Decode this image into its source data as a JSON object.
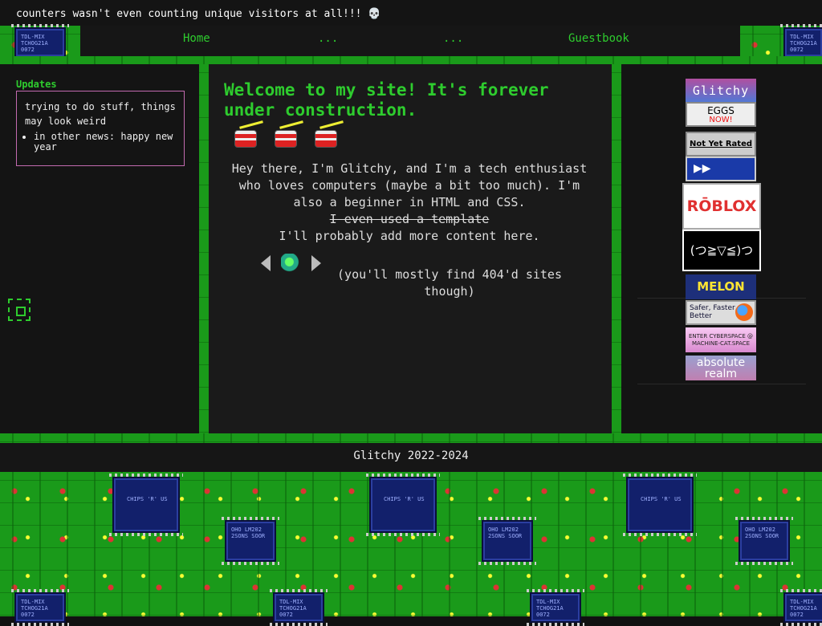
{
  "marquee": {
    "text": "counters wasn't even counting unique visitors at all!!! 💀"
  },
  "nav": {
    "home": "Home",
    "item2": "...",
    "item3": "...",
    "guestbook": "Guestbook"
  },
  "updates": {
    "title": "Updates",
    "body": "trying to do stuff, things may look weird",
    "bullet": "in other news: happy new year"
  },
  "main": {
    "welcome": "Welcome to my site! It's forever under construction.",
    "intro_line1": "Hey there, I'm Glitchy, and I'm a tech enthusiast who loves computers (maybe a bit too much). I'm also a beginner in HTML and CSS.",
    "intro_strike": "I even used a template",
    "intro_line2": "I'll probably add more content here.",
    "webring_note": "(you'll mostly find 404'd sites though)"
  },
  "badges": {
    "glitchy": "Glitchy",
    "eggs": "EGGS",
    "eggs_now": "NOW!",
    "not_yet_rated": "Not Yet Rated",
    "ff": "▶▶",
    "roblox": "RŌBLOX",
    "emoticon": "(つ≧▽≦)つ",
    "melon": "MELON",
    "firefox": "Safer, Faster, Better",
    "cyberspace": "ENTER CYBERSPACE @ MACHINE-CAT.SPACE",
    "absolute": "absolute realm"
  },
  "chip_labels": {
    "tdl": "TDL-MIX TCHOG21A 0072",
    "chips": "CHIPS 'R' US",
    "lm": "OHO LM202 2SONS SOOR"
  },
  "footer": {
    "text": "Glitchy 2022-2024"
  }
}
